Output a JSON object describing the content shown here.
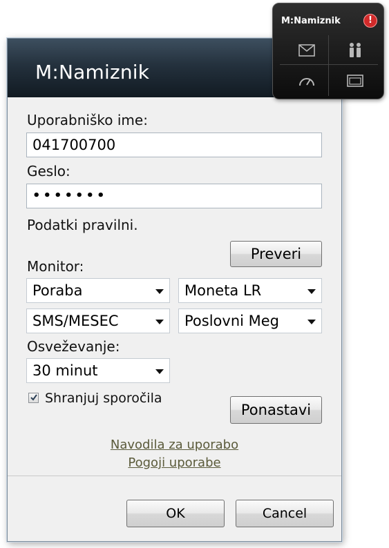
{
  "dialog": {
    "title": "M:Namiznik",
    "username_label": "Uporabniško ime:",
    "username_value": "041700700",
    "password_label": "Geslo:",
    "password_value": "•••••••",
    "status_text": "Podatki pravilni.",
    "check_button": "Preveri",
    "monitor_label": "Monitor:",
    "monitor_selects": [
      {
        "value": "Poraba"
      },
      {
        "value": "Moneta LR"
      },
      {
        "value": "SMS/MESEC"
      },
      {
        "value": "Poslovni Meg"
      }
    ],
    "refresh_label": "Osveževanje:",
    "refresh_value": "30 minut",
    "save_messages_label": "Shranjuj sporočila",
    "save_messages_checked": true,
    "reset_button": "Ponastavi",
    "links": {
      "instructions": "Navodila za uporabo",
      "terms": "Pogoji uporabe"
    },
    "ok_button": "OK",
    "cancel_button": "Cancel"
  },
  "gadget": {
    "title": "M:Namiznik",
    "alert_glyph": "!",
    "icons": [
      "mail-icon",
      "people-icon",
      "speedometer-icon",
      "window-icon"
    ]
  },
  "colors": {
    "header_dark": "#111a22",
    "link_color": "#5a5a3a",
    "alert_red": "#d12a2a"
  }
}
